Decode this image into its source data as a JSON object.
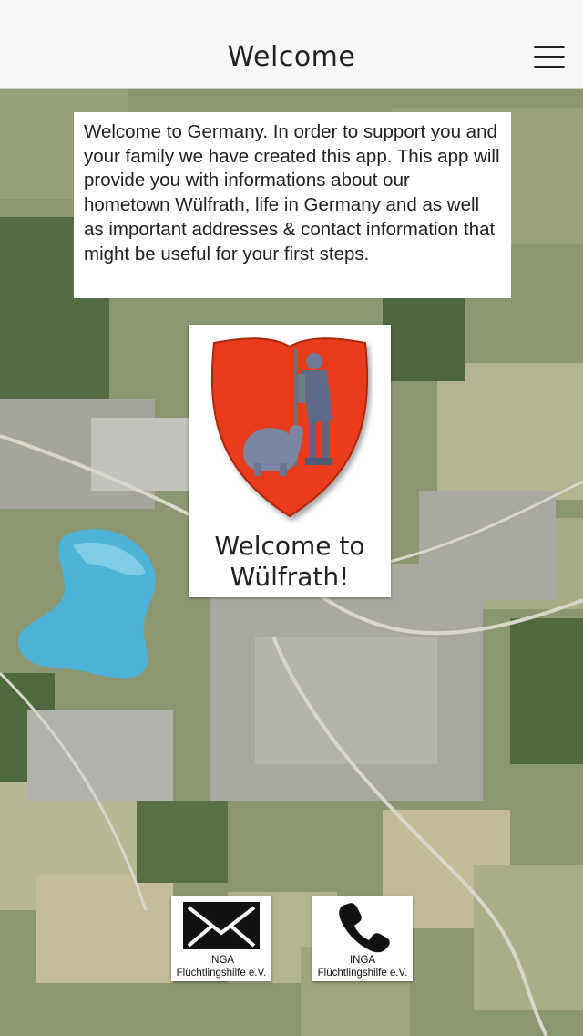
{
  "header": {
    "title": "Welcome",
    "menu_icon": "hamburger-menu-icon"
  },
  "intro": {
    "text": "Welcome to Germany. In order to support you and your family we have created this app. This app will provide you with informations about our hometown Wülfrath, life in Germany and as well as important addresses & contact information that might be useful for your first steps."
  },
  "crest": {
    "image": "wuelfrath-coat-of-arms",
    "caption_line1": "Welcome to",
    "caption_line2": "Wülfrath!"
  },
  "contacts": [
    {
      "icon": "envelope-icon",
      "line1": "INGA",
      "line2": "Flüchtlingshilfe e.V."
    },
    {
      "icon": "phone-icon",
      "line1": "INGA",
      "line2": "Flüchtlingshilfe e.V."
    }
  ],
  "colors": {
    "shield_red": "#e83a1e",
    "lake_blue": "#4fb3d8",
    "header_bg": "#f8f8f8"
  }
}
